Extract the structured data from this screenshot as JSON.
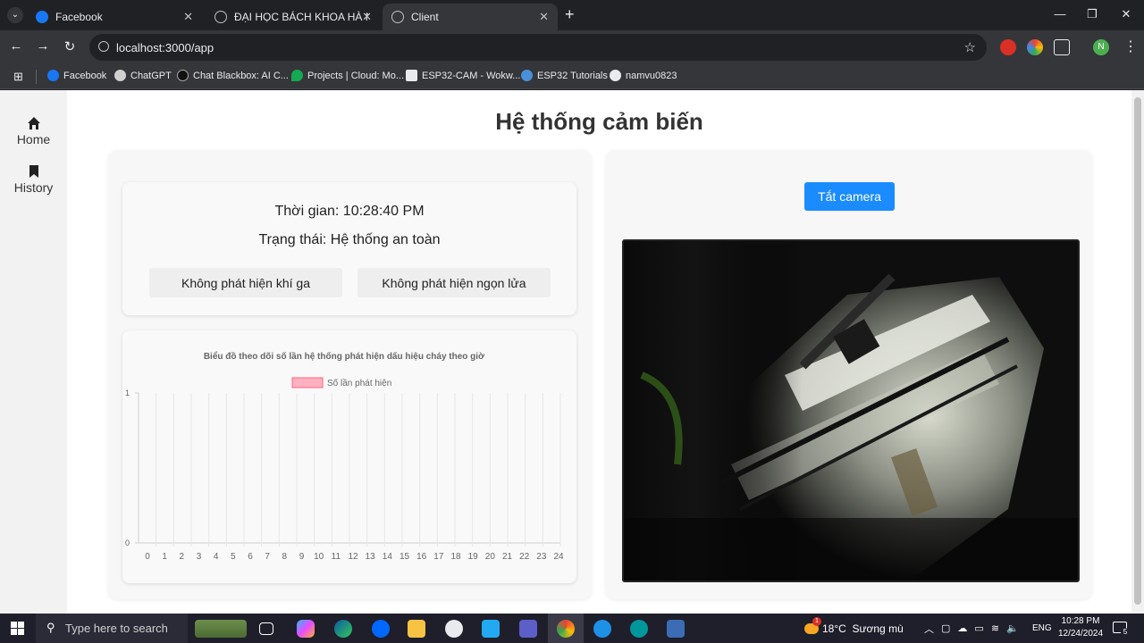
{
  "browser": {
    "tabs": [
      {
        "title": "Facebook",
        "active": false,
        "favicon": "facebook-icon"
      },
      {
        "title": "ĐẠI HỌC BÁCH KHOA HÀ NỘI",
        "active": false,
        "favicon": "globe-icon"
      },
      {
        "title": "Client",
        "active": true,
        "favicon": "globe-icon"
      }
    ],
    "new_tab": "+",
    "url": "localhost:3000/app",
    "profile_initial": "N",
    "bookmarks": [
      {
        "label": "Facebook",
        "icon": "facebook-icon"
      },
      {
        "label": "ChatGPT",
        "icon": "chatgpt-icon"
      },
      {
        "label": "Chat Blackbox: AI C...",
        "icon": "blackbox-icon"
      },
      {
        "label": "Projects | Cloud: Mo...",
        "icon": "mongodb-icon"
      },
      {
        "label": "ESP32-CAM - Wokw...",
        "icon": "wokwi-icon"
      },
      {
        "label": "ESP32 Tutorials",
        "icon": "esp32-icon"
      },
      {
        "label": "namvu0823",
        "icon": "github-icon"
      }
    ]
  },
  "sidebar": {
    "items": [
      {
        "label": "Home",
        "icon": "home-icon"
      },
      {
        "label": "History",
        "icon": "bookmark-icon"
      }
    ]
  },
  "page": {
    "title": "Hệ thống cảm biến",
    "time_label": "Thời gian: 10:28:40 PM",
    "status_label": "Trạng thái: Hệ thống an toàn",
    "gas_status": "Không phát hiện khí ga",
    "fire_status": "Không phát hiện ngọn lửa",
    "camera_button": "Tắt camera"
  },
  "chart_data": {
    "type": "bar",
    "title": "Biểu đồ theo dõi số lần hệ thống phát hiện dấu hiệu cháy theo giờ",
    "legend": "Số lần phát hiện",
    "legend_color": "#ffb1c1",
    "categories": [
      "0",
      "1",
      "2",
      "3",
      "4",
      "5",
      "6",
      "7",
      "8",
      "9",
      "10",
      "11",
      "12",
      "13",
      "14",
      "15",
      "16",
      "17",
      "18",
      "19",
      "20",
      "21",
      "22",
      "23",
      "24"
    ],
    "series": [
      {
        "name": "Số lần phát hiện",
        "values": [
          0,
          0,
          0,
          0,
          0,
          0,
          0,
          0,
          0,
          0,
          0,
          0,
          0,
          0,
          0,
          0,
          0,
          0,
          0,
          0,
          0,
          0,
          0,
          0,
          0
        ]
      }
    ],
    "ylim": [
      0,
      1
    ],
    "y_ticks": [
      "0",
      "1"
    ],
    "grid": true,
    "legend_position": "top"
  },
  "taskbar": {
    "search_placeholder": "Type here to search",
    "weather_badge": "1",
    "weather": "18°C  Sương mù",
    "language": "ENG",
    "time": "10:28 PM",
    "date": "12/24/2024",
    "notification_count": "5"
  },
  "colors": {
    "accent": "#1a8cff",
    "legend": "#ffb1c1"
  }
}
